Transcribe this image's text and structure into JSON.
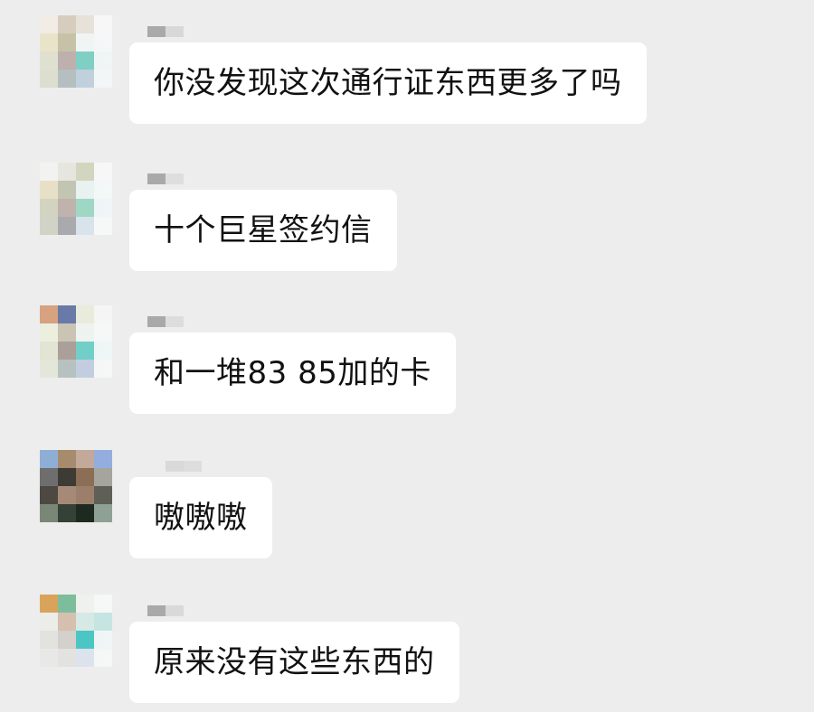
{
  "colors": {
    "background": "#ededed",
    "bubble": "#ffffff",
    "text": "#111111"
  },
  "messages": [
    {
      "text": "你没发现这次通行证东西更多了吗",
      "sender_name_blurred": true,
      "avatar_blurred": true,
      "avatar_cells": [
        "#f1ece5",
        "#d6cdbf",
        "#e6e2da",
        "#f7f7f7",
        "#e9e4c9",
        "#c7c2a7",
        "#f0f5f3",
        "#f4f7f7",
        "#dfe0d0",
        "#bdb0ad",
        "#7fcfc4",
        "#eff5f4",
        "#dcdfd0",
        "#b5bec0",
        "#c0d0dd",
        "#f3f6f7"
      ],
      "sender_cells": [
        "#a9a9a9",
        "#d8d8d8"
      ]
    },
    {
      "text": "十个巨星签约信",
      "sender_name_blurred": true,
      "avatar_blurred": true,
      "avatar_cells": [
        "#f2f2f0",
        "#e6e6de",
        "#d3d6bf",
        "#f6f7f6",
        "#e7e0c6",
        "#c2c5b1",
        "#e8f2f0",
        "#f3f7f7",
        "#d3d3c2",
        "#c0b2ad",
        "#9ed8c5",
        "#eff5f7",
        "#d1d3c7",
        "#a9aaae",
        "#d9e3ec",
        "#f6f7f7"
      ],
      "sender_cells": [
        "#a9a9a9",
        "#dedede"
      ]
    },
    {
      "text": "和一堆83 85加的卡",
      "sender_name_blurred": true,
      "avatar_blurred": true,
      "avatar_cells": [
        "#d6a27f",
        "#6a7aa8",
        "#e9ecdc",
        "#f5f5f5",
        "#eceede",
        "#c9c4b4",
        "#eef3f0",
        "#f6f7f7",
        "#e2e4d4",
        "#ab9f99",
        "#71cfc7",
        "#eef5f5",
        "#e3e7da",
        "#b7c2c0",
        "#c2cee0",
        "#f5f7f7"
      ],
      "sender_cells": [
        "#a9a9a9",
        "#dddddd"
      ]
    },
    {
      "text": "嗷嗷嗷",
      "sender_name_blurred": true,
      "avatar_blurred": true,
      "avatar_cells": [
        "#8faed6",
        "#a68c6c",
        "#c3a999",
        "#93aede",
        "#6f6e6f",
        "#3e3b35",
        "#8c6d55",
        "#a6a59d",
        "#4d4942",
        "#a58a78",
        "#9b7f6b",
        "#5f6055",
        "#7a8776",
        "#344136",
        "#1e2a1f",
        "#8fa195"
      ],
      "sender_cells": [
        "#d9d9d9",
        "#dddddd"
      ]
    },
    {
      "text": "原来没有这些东西的",
      "sender_name_blurred": true,
      "avatar_blurred": true,
      "avatar_cells": [
        "#d9a45a",
        "#7dbd9c",
        "#eef1ec",
        "#f6f7f7",
        "#ecede8",
        "#d5bfae",
        "#d7e9e4",
        "#c6e5e2",
        "#e2e2de",
        "#d4d0cb",
        "#4cc6c4",
        "#eff5f5",
        "#e8e9e6",
        "#e2e3e1",
        "#dde3ec",
        "#f5f7f7"
      ],
      "sender_cells": [
        "#a9a9a9",
        "#d9d9d9"
      ]
    }
  ]
}
